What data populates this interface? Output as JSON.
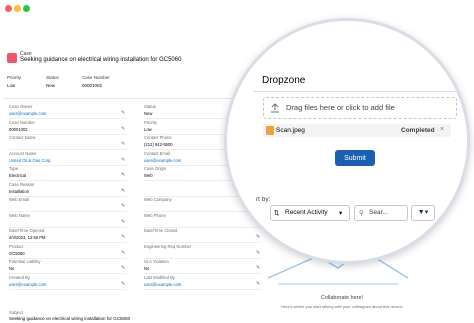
{
  "case_header": {
    "type_label": "Case",
    "title": "Seeking guidance on electrical wiring installation for GC5060",
    "fields": [
      {
        "label": "Priority",
        "value": "Low"
      },
      {
        "label": "Status",
        "value": "New"
      },
      {
        "label": "Case Number",
        "value": "00001002"
      }
    ]
  },
  "detail_fields": [
    {
      "label": "Case Owner",
      "value": "user@example.com",
      "link": true
    },
    {
      "label": "Status",
      "value": "New",
      "link": false
    },
    {
      "label": "Case Number",
      "value": "00001002",
      "link": false
    },
    {
      "label": "Priority",
      "value": "Low",
      "link": false
    },
    {
      "label": "Contact Name",
      "value": "",
      "link": false
    },
    {
      "label": "Contact Phone",
      "value": "(212) 842-5500",
      "link": false
    },
    {
      "label": "Account Name",
      "value": "United Oil & Gas Corp.",
      "link": true
    },
    {
      "label": "Contact Email",
      "value": "user@example.com",
      "link": true
    },
    {
      "label": "Type",
      "value": "Electrical",
      "link": false
    },
    {
      "label": "Case Origin",
      "value": "Web",
      "link": false
    },
    {
      "label": "Case Reason",
      "value": "Installation",
      "link": false
    },
    {
      "label": "",
      "value": "",
      "link": false
    },
    {
      "label": "Web Email",
      "value": "",
      "link": false
    },
    {
      "label": "Web Company",
      "value": "",
      "link": false
    },
    {
      "label": "Web Name",
      "value": "",
      "link": false
    },
    {
      "label": "Web Phone",
      "value": "",
      "link": false
    },
    {
      "label": "Date/Time Opened",
      "value": "4/3/2023, 12:50 PM",
      "link": false
    },
    {
      "label": "Date/Time Closed",
      "value": "",
      "link": false
    },
    {
      "label": "Product",
      "value": "GC5060",
      "link": false
    },
    {
      "label": "Engineering Req Number",
      "value": "",
      "link": false
    },
    {
      "label": "Potential Liability",
      "value": "No",
      "link": false
    },
    {
      "label": "SLA Violation",
      "value": "No",
      "link": false
    },
    {
      "label": "Created By",
      "value": "user@example.com",
      "link": true
    },
    {
      "label": "Last Modified By",
      "value": "user@example.com",
      "link": true
    }
  ],
  "subject": {
    "label": "Subject",
    "value": "Seeking guidance on electrical wiring installation for GC5060"
  },
  "dropzone": {
    "title": "Dropzone",
    "drop_text": "Drag files here or click to add file",
    "file": {
      "name": "Scan.jpeg",
      "status": "Completed"
    },
    "submit_label": "Submit"
  },
  "activity": {
    "by_text": "rt by:",
    "sort_value": "Recent Activity",
    "search_placeholder": "Sear...",
    "collab_title": "Collaborate here!",
    "collab_sub": "Here's where you start talking with your colleagues about this record."
  },
  "colors": {
    "accent": "#1b5fb2",
    "case_icon": "#f2536d",
    "link": "#0070d2"
  }
}
